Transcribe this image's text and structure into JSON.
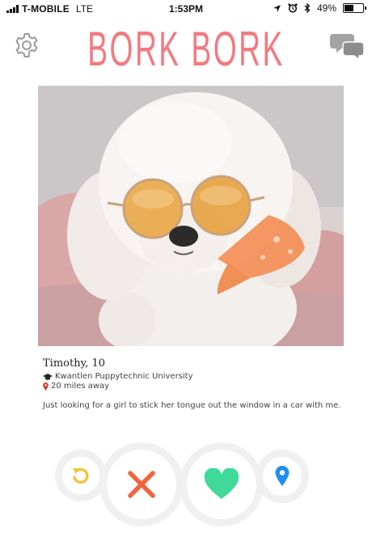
{
  "status_bar": {
    "carrier": "T-MOBILE",
    "network": "LTE",
    "time": "1:53PM",
    "battery": "49%",
    "battery_level": 0.49
  },
  "header": {
    "title": "BORK BORK",
    "settings_icon": "gear-icon",
    "chat_icon": "chat-bubbles-icon"
  },
  "profile": {
    "name_age": "Timothy, 10",
    "school": "Kwantlen Puppytechnic University",
    "distance": "20 miles away",
    "bio": "Just looking for a girl to stick her tongue out the window in a car with me.",
    "school_icon": "graduation-cap-icon",
    "distance_icon": "map-pin-icon"
  },
  "actions": {
    "rewind_icon": "rewind-icon",
    "nope_icon": "close-x-icon",
    "like_icon": "heart-icon",
    "location_icon": "location-pin-icon"
  },
  "colors": {
    "brand": "#f27a80",
    "rewind": "#f5c33b",
    "nope": "#f0653e",
    "like": "#3fd99a",
    "location": "#1f8ef1",
    "icon_gray": "#9a9a9a"
  }
}
